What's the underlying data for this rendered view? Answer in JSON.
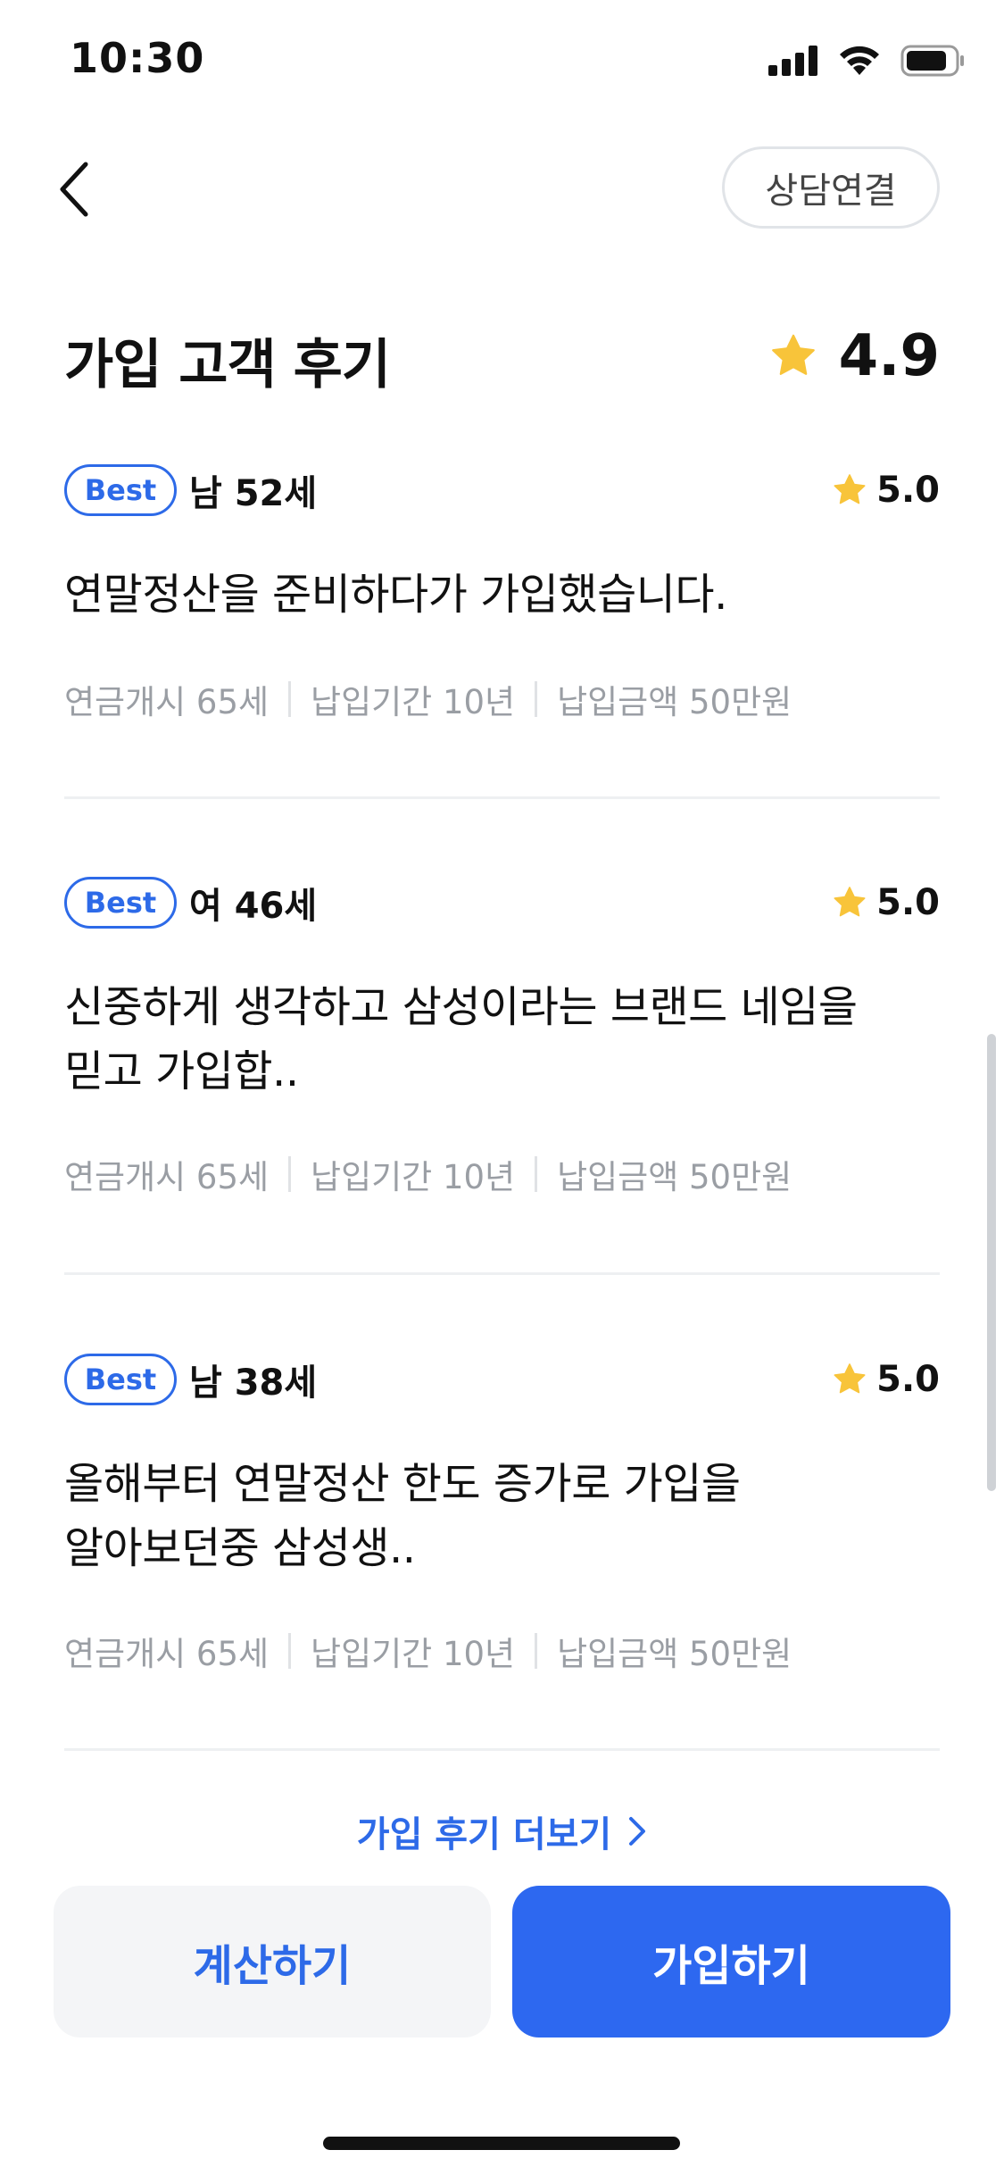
{
  "status_bar": {
    "time": "10:30"
  },
  "nav": {
    "consult_label": "상담연결"
  },
  "header": {
    "title": "가입 고객 후기",
    "overall_rating": "4.9"
  },
  "reviews": [
    {
      "badge": "Best",
      "reviewer": "남 52세",
      "rating": "5.0",
      "text": "연말정산을 준비하다가 가입했습니다.",
      "meta": [
        "연금개시 65세",
        "납입기간 10년",
        "납입금액 50만원"
      ]
    },
    {
      "badge": "Best",
      "reviewer": "여 46세",
      "rating": "5.0",
      "text_lines": [
        "신중하게 생각하고 삼성이라는 브랜드 네임을",
        "믿고 가입합.."
      ],
      "meta": [
        "연금개시 65세",
        "납입기간 10년",
        "납입금액 50만원"
      ]
    },
    {
      "badge": "Best",
      "reviewer": "남 38세",
      "rating": "5.0",
      "text_lines": [
        "올해부터 연말정산 한도 증가로 가입을",
        "알아보던중 삼성생.."
      ],
      "meta": [
        "연금개시 65세",
        "납입기간 10년",
        "납입금액 50만원"
      ]
    }
  ],
  "more_link": "가입 후기 더보기",
  "buttons": {
    "calculate": "계산하기",
    "join": "가입하기"
  },
  "colors": {
    "accent": "#2d6ae8",
    "star": "#f8c43a",
    "primary_button": "#2d68f0"
  },
  "icons": [
    "signal-icon",
    "wifi-icon",
    "battery-icon",
    "back-chevron-icon",
    "star-icon",
    "chevron-right-icon"
  ]
}
